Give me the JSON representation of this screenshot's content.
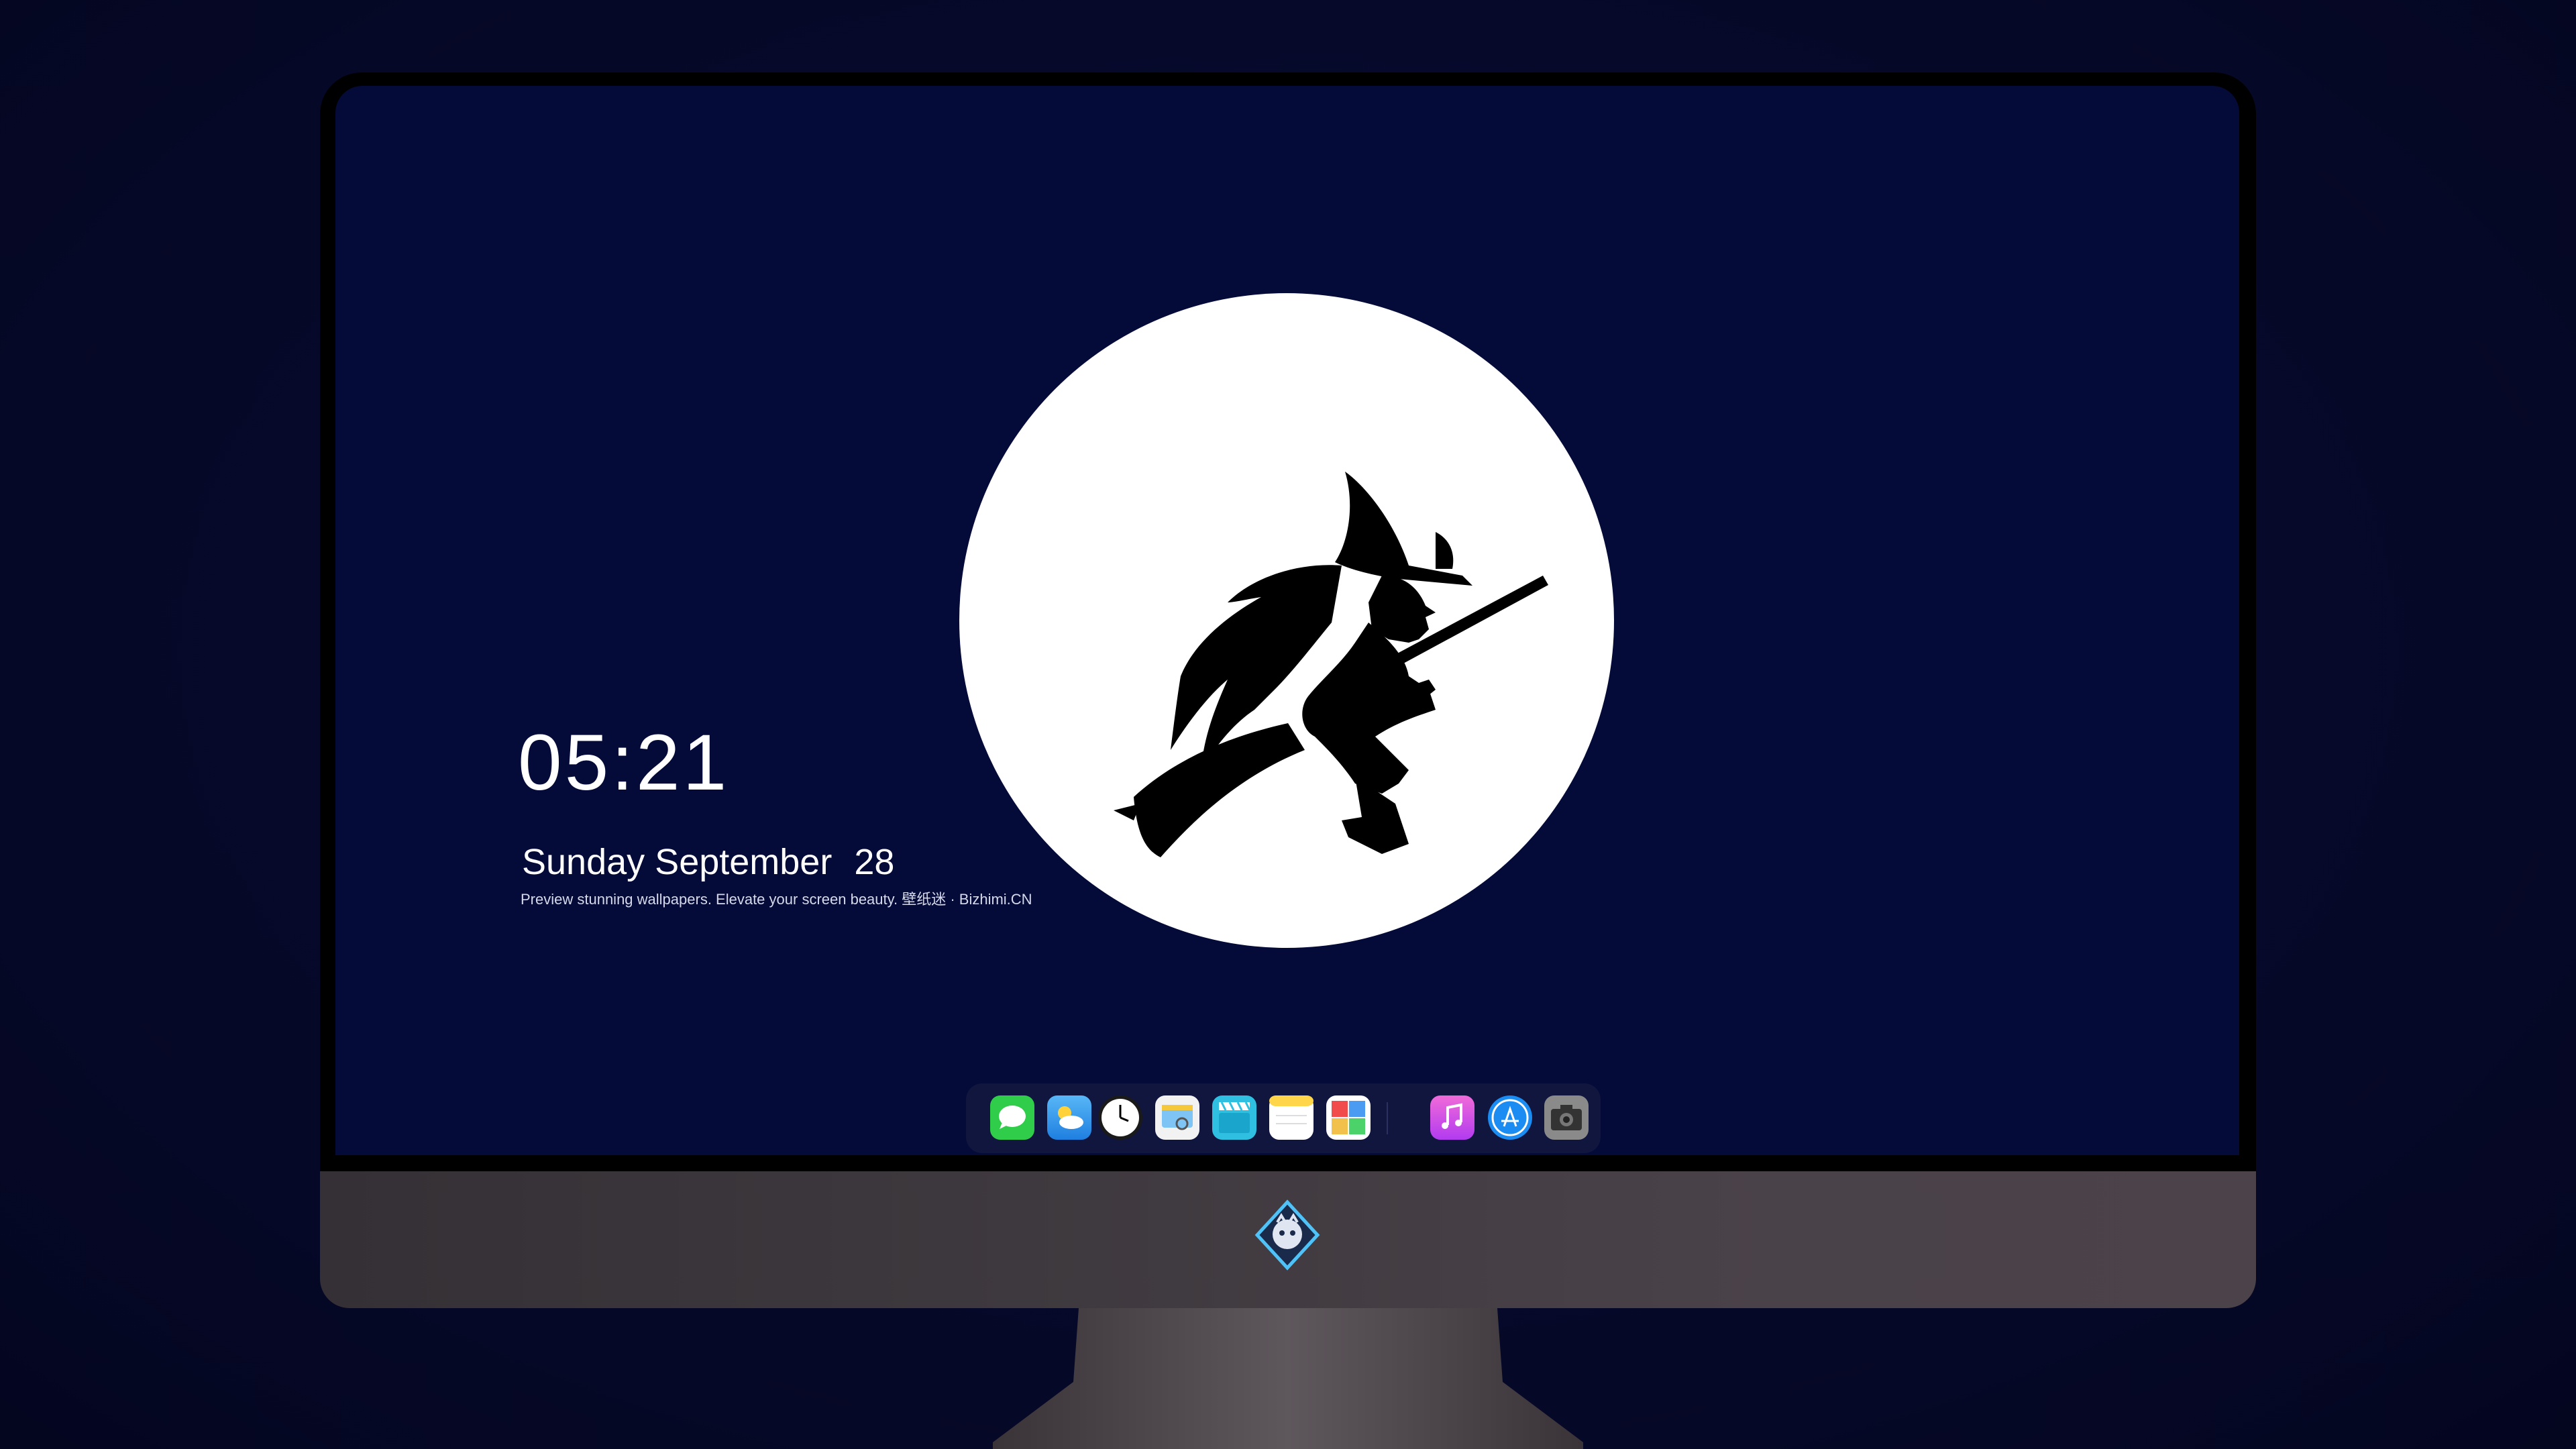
{
  "clock": {
    "time": "05:21",
    "weekday": "Sunday",
    "month": "September",
    "day": "28",
    "tagline": "Preview stunning wallpapers. Elevate your screen beauty. 壁纸迷 · Bizhimi.CN"
  },
  "wallpaper": {
    "background_color": "#040b38",
    "moon_color": "#ffffff",
    "silhouette_color": "#000000",
    "subject": "witch-on-broomstick"
  },
  "dock": {
    "apps": [
      {
        "name": "messages-icon",
        "color": "#2fcd4a"
      },
      {
        "name": "weather-icon",
        "color": "#3aa6f0"
      },
      {
        "name": "clock-icon",
        "color": "#111111"
      },
      {
        "name": "preview-icon",
        "color": "#f5f5f5"
      },
      {
        "name": "clips-icon",
        "color": "#34c3e0"
      },
      {
        "name": "notes-icon",
        "color": "#ffd54a"
      },
      {
        "name": "photo-booth-icon",
        "color": "#ffffff"
      },
      {
        "name": "itunes-icon",
        "color": "#d24bf0"
      },
      {
        "name": "app-store-icon",
        "color": "#1b8cf2"
      },
      {
        "name": "camera-icon",
        "color": "#8a8a8a"
      }
    ]
  },
  "monitor": {
    "chin_logo": "bizhimi-logo"
  }
}
